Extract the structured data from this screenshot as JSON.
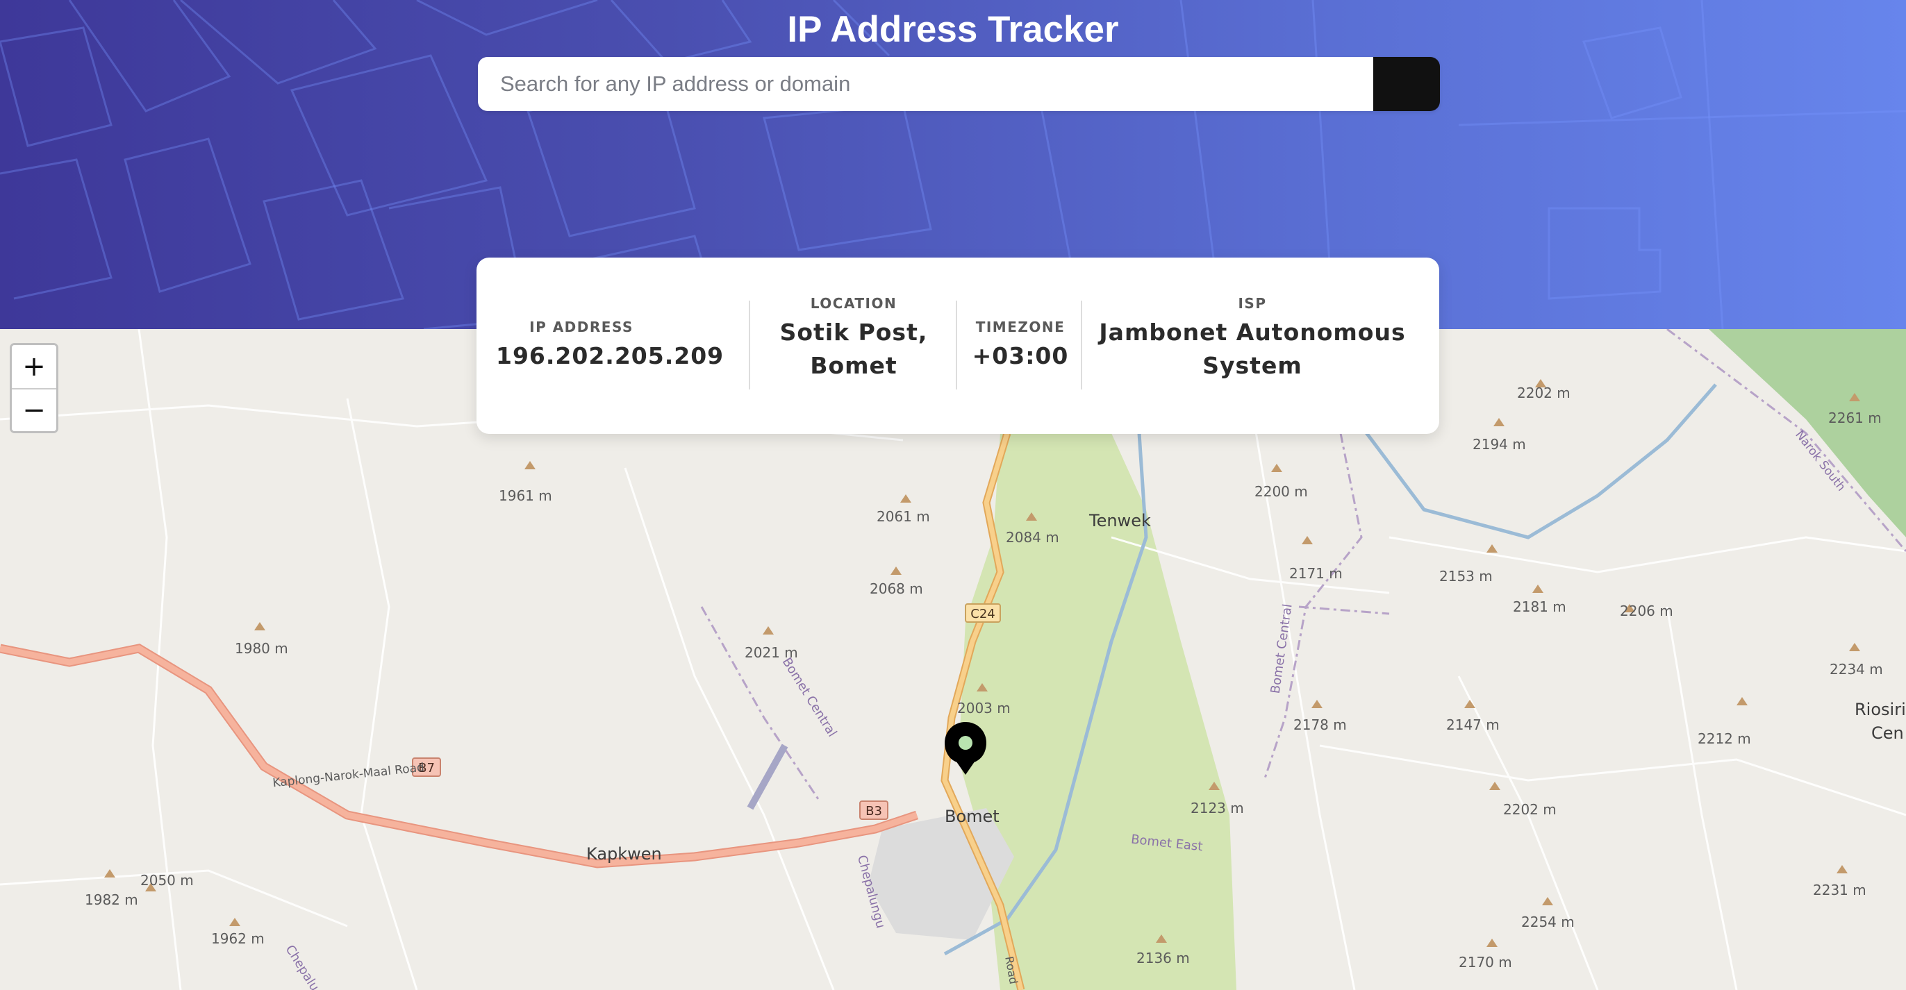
{
  "app": {
    "title": "IP Address Tracker"
  },
  "search": {
    "placeholder": "Search for any IP address or domain",
    "value": ""
  },
  "info": {
    "ip_label": "IP ADDRESS",
    "ip_value": "196.202.205.209",
    "location_label": "LOCATION",
    "location_line1": "Sotik Post,",
    "location_line2": "Bomet",
    "timezone_label": "TIMEZONE",
    "timezone_value": "+03:00",
    "isp_label": "ISP",
    "isp_line1": "Jambonet Autonomous",
    "isp_line2": "System"
  },
  "zoom": {
    "in_label": "+",
    "out_label": "−"
  },
  "map": {
    "places": {
      "tenwek": "Tenwek",
      "bomet": "Bomet",
      "kapkwen": "Kapkwen",
      "riosiri": "Riosiri",
      "cen": "Cen"
    },
    "roads": {
      "b7_shield": "B7",
      "b3_shield": "B3",
      "c24_shield": "C24",
      "b7_name": "Kaplong-Narok-Maal Road",
      "bomet_central_1": "Bomet Central",
      "bomet_central_2": "Bomet Central",
      "bomet_east": "Bomet East",
      "chepalungu_1": "Chepalungu",
      "chepalungu_2": "Chepalu",
      "narok_south": "Narok South",
      "road_label": "Road"
    },
    "peaks": [
      "1961 m",
      "2061 m",
      "2084 m",
      "2068 m",
      "1980 m",
      "2021 m",
      "2003 m",
      "2050 m",
      "1982 m",
      "1962 m",
      "2200 m",
      "2171 m",
      "2153 m",
      "2181 m",
      "2206 m",
      "2178 m",
      "2147 m",
      "2202 m",
      "2194 m",
      "2261 m",
      "2234 m",
      "2212 m",
      "2123 m",
      "2202 m",
      "2254 m",
      "2231 m",
      "2170 m",
      "2136 m"
    ]
  }
}
